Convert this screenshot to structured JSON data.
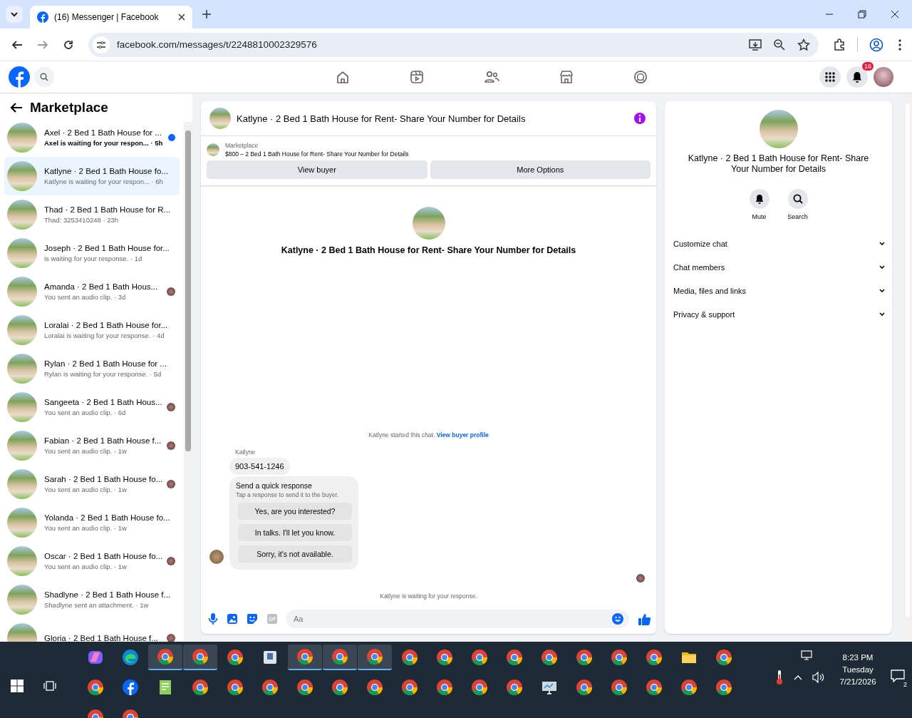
{
  "browser": {
    "tab_title": "(16) Messenger | Facebook",
    "url": "facebook.com/messages/t/2248810002329576"
  },
  "topnav": {
    "notification_count": "16"
  },
  "sidebar": {
    "title": "Marketplace",
    "conversations": [
      {
        "name": "Axel · 2 Bed 1 Bath House for ...",
        "preview": "Axel is waiting for your respon...",
        "time": "· 5h",
        "unread": true,
        "selected": false,
        "seen": false
      },
      {
        "name": "Katlyne · 2 Bed 1 Bath House fo...",
        "preview": "Katlyne is waiting for your respon...",
        "time": "· 6h",
        "unread": false,
        "selected": true,
        "seen": false
      },
      {
        "name": "Thad · 2 Bed 1 Bath House for R...",
        "preview": "Thad: 3253410248",
        "time": "· 23h",
        "unread": false,
        "selected": false,
        "seen": false
      },
      {
        "name": "Joseph · 2 Bed 1 Bath House for...",
        "preview": "is waiting for your response.",
        "time": "· 1d",
        "unread": false,
        "selected": false,
        "seen": false
      },
      {
        "name": "Amanda · 2 Bed 1 Bath Hous...",
        "preview": "You sent an audio clip.",
        "time": "· 3d",
        "unread": false,
        "selected": false,
        "seen": true
      },
      {
        "name": "Loralai · 2 Bed 1 Bath House for...",
        "preview": "Loralai is waiting for your response.",
        "time": "· 4d",
        "unread": false,
        "selected": false,
        "seen": false
      },
      {
        "name": "Rylan · 2 Bed 1 Bath House for ...",
        "preview": "Rylan is waiting for your response.",
        "time": "· 5d",
        "unread": false,
        "selected": false,
        "seen": false
      },
      {
        "name": "Sangeeta · 2 Bed 1 Bath Hous...",
        "preview": "You sent an audio clip.",
        "time": "· 6d",
        "unread": false,
        "selected": false,
        "seen": true
      },
      {
        "name": "Fabian · 2 Bed 1 Bath House f...",
        "preview": "You sent an audio clip.",
        "time": "· 1w",
        "unread": false,
        "selected": false,
        "seen": true
      },
      {
        "name": "Sarah · 2 Bed 1 Bath House fo...",
        "preview": "You sent an audio clip.",
        "time": "· 1w",
        "unread": false,
        "selected": false,
        "seen": true
      },
      {
        "name": "Yolanda · 2 Bed 1 Bath House fo...",
        "preview": "You sent an audio clip.",
        "time": "· 1w",
        "unread": false,
        "selected": false,
        "seen": false
      },
      {
        "name": "Oscar · 2 Bed 1 Bath House fo...",
        "preview": "You sent an audio clip.",
        "time": "· 1w",
        "unread": false,
        "selected": false,
        "seen": true
      },
      {
        "name": "Shadlyne · 2 Bed 1 Bath House f...",
        "preview": "Shadlyne sent an attachment.",
        "time": "· 1w",
        "unread": false,
        "selected": false,
        "seen": false
      },
      {
        "name": "Gloria · 2 Bed 1 Bath House f...",
        "unread": false,
        "selected": false,
        "seen": true
      }
    ]
  },
  "chat": {
    "title": "Katlyne · 2 Bed 1 Bath House for Rent- Share Your Number for Details",
    "listing": {
      "label": "Marketplace",
      "text": "$800 – 2 Bed 1 Bath House for Rent- Share Your Number for Details"
    },
    "buttons": [
      "View buyer",
      "More Options"
    ],
    "intro_title": "Katlyne · 2 Bed 1 Bath House for Rent- Share Your Number for Details",
    "started_text": "Katlyne started this chat.",
    "started_link": "View buyer profile",
    "sender": "Katlyne",
    "message": "903-541-1246",
    "quick": {
      "title": "Send a quick response",
      "hint": "Tap a response to send it to the buyer.",
      "options": [
        "Yes, are you interested?",
        "In talks. I'll let you know.",
        "Sorry, it's not available."
      ]
    },
    "status": "Katlyne is waiting for your response.",
    "composer": {
      "placeholder": "Aa"
    }
  },
  "details": {
    "title": "Katlyne · 2 Bed 1 Bath House for Rent- Share Your Number for Details",
    "actions": [
      {
        "label": "Mute",
        "kind": "bell"
      },
      {
        "label": "Search",
        "kind": "search"
      }
    ],
    "sections": [
      "Customize chat",
      "Chat members",
      "Media, files and links",
      "Privacy & support"
    ]
  },
  "taskbar": {
    "time": "8:23 PM",
    "day": "Tuesday",
    "date": "7/21/2026",
    "notifications": "2"
  }
}
